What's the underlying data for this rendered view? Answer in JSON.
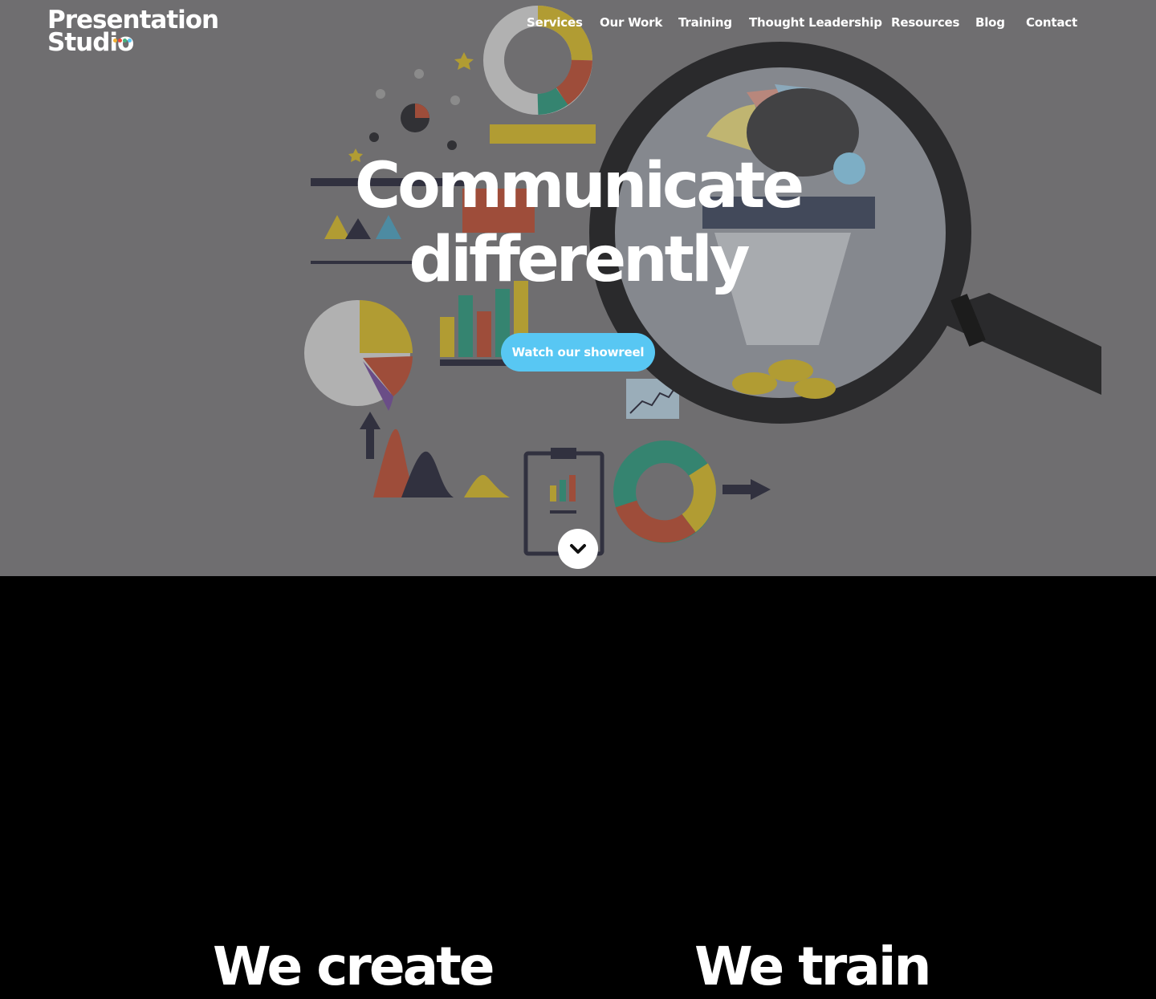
{
  "logo": {
    "line1": "Presentation",
    "line2": "Studio",
    "dot_colors": [
      "#f2b233",
      "#ea4b3d",
      "#48b37f",
      "#58c7f3"
    ]
  },
  "nav": {
    "items": [
      "Services",
      "Our Work",
      "Training",
      "Thought Leadership",
      "Resources",
      "Blog",
      "Contact"
    ]
  },
  "hero": {
    "line1": "Communicate",
    "line2": "differently",
    "cta": "Watch our showreel",
    "bg_color": "#6f6e70",
    "accent": "#58c7f3"
  },
  "icons": {
    "scroll": "chevron-down-icon",
    "art": "data-illustration"
  },
  "section2": {
    "left_heading": "We create",
    "right_heading": "We train"
  }
}
